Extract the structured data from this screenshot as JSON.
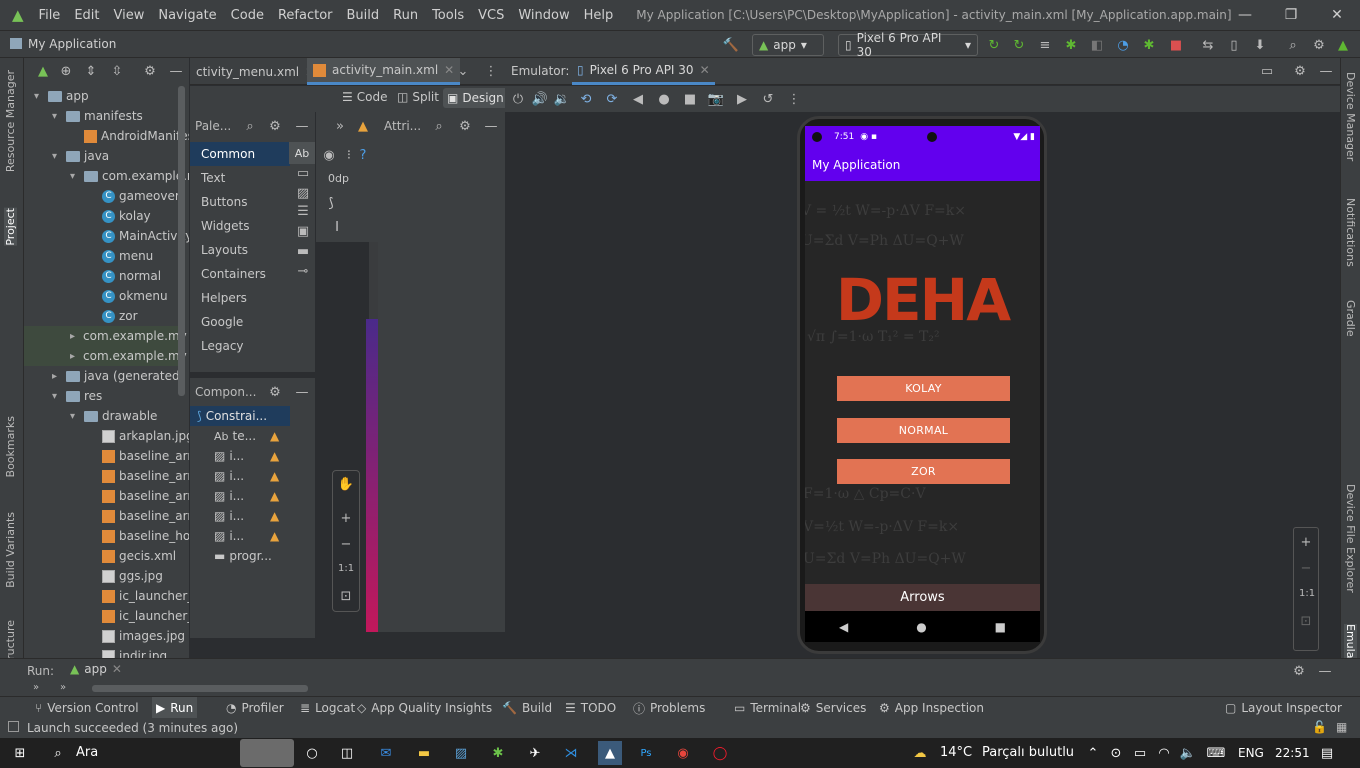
{
  "titlebar": {
    "menu": [
      "File",
      "Edit",
      "View",
      "Navigate",
      "Code",
      "Refactor",
      "Build",
      "Run",
      "Tools",
      "VCS",
      "Window",
      "Help"
    ],
    "window_title": "My Application [C:\\Users\\PC\\Desktop\\MyApplication] - activity_main.xml [My_Application.app.main]"
  },
  "navbar": {
    "project": "My Application",
    "run_config": "app",
    "device": "Pixel 6 Pro API 30"
  },
  "left_tabs": [
    "Resource Manager",
    "Project",
    "Bookmarks",
    "Build Variants",
    "Structure"
  ],
  "project_tree": [
    {
      "label": "app",
      "indent": 0,
      "icon": "folder",
      "arrow": "▾"
    },
    {
      "label": "manifests",
      "indent": 1,
      "icon": "folder",
      "arrow": "▾"
    },
    {
      "label": "AndroidManifest",
      "indent": 2,
      "icon": "xml",
      "arrow": ""
    },
    {
      "label": "java",
      "indent": 1,
      "icon": "folder",
      "arrow": "▾"
    },
    {
      "label": "com.example.my",
      "indent": 2,
      "icon": "folder",
      "arrow": "▾"
    },
    {
      "label": "gameover",
      "indent": 3,
      "icon": "class",
      "arrow": ""
    },
    {
      "label": "kolay",
      "indent": 3,
      "icon": "class",
      "arrow": ""
    },
    {
      "label": "MainActivity",
      "indent": 3,
      "icon": "class",
      "arrow": ""
    },
    {
      "label": "menu",
      "indent": 3,
      "icon": "class",
      "arrow": ""
    },
    {
      "label": "normal",
      "indent": 3,
      "icon": "class",
      "arrow": ""
    },
    {
      "label": "okmenu",
      "indent": 3,
      "icon": "class",
      "arrow": ""
    },
    {
      "label": "zor",
      "indent": 3,
      "icon": "class",
      "arrow": ""
    },
    {
      "label": "com.example.my",
      "indent": 2,
      "icon": "folder",
      "arrow": "▸"
    },
    {
      "label": "com.example.my",
      "indent": 2,
      "icon": "folder",
      "arrow": "▸"
    },
    {
      "label": "java (generated)",
      "indent": 1,
      "icon": "folder",
      "arrow": "▸"
    },
    {
      "label": "res",
      "indent": 1,
      "icon": "folder",
      "arrow": "▾"
    },
    {
      "label": "drawable",
      "indent": 2,
      "icon": "folder",
      "arrow": "▾"
    },
    {
      "label": "arkaplan.jpg",
      "indent": 3,
      "icon": "image",
      "arrow": ""
    },
    {
      "label": "baseline_arro",
      "indent": 3,
      "icon": "xml",
      "arrow": ""
    },
    {
      "label": "baseline_arro",
      "indent": 3,
      "icon": "xml",
      "arrow": ""
    },
    {
      "label": "baseline_arro",
      "indent": 3,
      "icon": "xml",
      "arrow": ""
    },
    {
      "label": "baseline_arro",
      "indent": 3,
      "icon": "xml",
      "arrow": ""
    },
    {
      "label": "baseline_hom",
      "indent": 3,
      "icon": "xml",
      "arrow": ""
    },
    {
      "label": "gecis.xml",
      "indent": 3,
      "icon": "xml",
      "arrow": ""
    },
    {
      "label": "ggs.jpg",
      "indent": 3,
      "icon": "image",
      "arrow": ""
    },
    {
      "label": "ic_launcher_b",
      "indent": 3,
      "icon": "xml",
      "arrow": ""
    },
    {
      "label": "ic_launcher_f",
      "indent": 3,
      "icon": "xml",
      "arrow": ""
    },
    {
      "label": "images.jpg",
      "indent": 3,
      "icon": "image",
      "arrow": ""
    },
    {
      "label": "indir.jpg",
      "indent": 3,
      "icon": "image",
      "arrow": ""
    }
  ],
  "editor_tabs": [
    "ctivity_menu.xml",
    "activity_main.xml"
  ],
  "view_modes": [
    "Code",
    "Split",
    "Design"
  ],
  "palette": {
    "title": "Pale...",
    "categories": [
      "Common",
      "Text",
      "Buttons",
      "Widgets",
      "Layouts",
      "Containers",
      "Helpers",
      "Google",
      "Legacy"
    ],
    "selected": "Common",
    "ab": "Ab",
    "dp": "0dp"
  },
  "component_tree": {
    "title": "Compon...",
    "root": "Constrai...",
    "children": [
      "te...",
      "i...",
      "i...",
      "i...",
      "i...",
      "i...",
      "progr..."
    ]
  },
  "attributes": {
    "title": "Attri..."
  },
  "emulator": {
    "label": "Emulator:",
    "tab": "Pixel 6 Pro API 30"
  },
  "phone": {
    "time": "7:51",
    "app_title": "My Application",
    "heading": "DEHA",
    "buttons": [
      "KOLAY",
      "NORMAL",
      "ZOR"
    ],
    "bottom_label": "Arrows"
  },
  "zoom": {
    "ratio": "1:1"
  },
  "right_tabs": [
    "Device Manager",
    "Notifications",
    "Gradle",
    "Device File Explorer",
    "Emulator"
  ],
  "run": {
    "label": "Run:",
    "config": "app"
  },
  "tool_windows": [
    "Version Control",
    "Run",
    "Profiler",
    "Logcat",
    "App Quality Insights",
    "Build",
    "TODO",
    "Problems",
    "Terminal",
    "Services",
    "App Inspection",
    "Layout Inspector"
  ],
  "status": {
    "message": "Launch succeeded (3 minutes ago)"
  },
  "taskbar": {
    "search": "Ara",
    "weather_temp": "14°C",
    "weather_desc": "Parçalı bulutlu",
    "lang": "ENG",
    "time": "22:51"
  }
}
